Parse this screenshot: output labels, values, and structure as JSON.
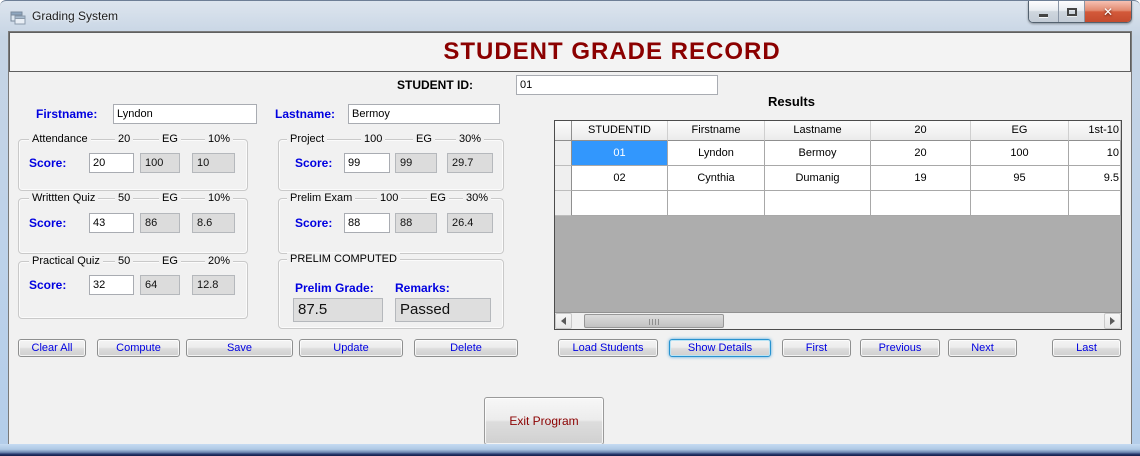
{
  "colors": {
    "maroon": "#8b0000",
    "blue": "#0000e0",
    "sel": "#3297fd",
    "formbg": "#f1f1f1"
  },
  "window": {
    "title": "Grading System"
  },
  "header": {
    "title": "STUDENT GRADE RECORD"
  },
  "student_id": {
    "label": "STUDENT ID:",
    "value": "01"
  },
  "firstname": {
    "label": "Firstname:",
    "value": "Lyndon"
  },
  "lastname": {
    "label": "Lastname:",
    "value": "Bermoy"
  },
  "score_label": "Score:",
  "groups": [
    {
      "caption": "Attendance",
      "max": "20",
      "eg_label": "EG",
      "percent": "10%",
      "score": "20",
      "eg": "100",
      "weighted": "10"
    },
    {
      "caption": "Writtten Quiz",
      "max": "50",
      "eg_label": "EG",
      "percent": "10%",
      "score": "43",
      "eg": "86",
      "weighted": "8.6"
    },
    {
      "caption": "Practical Quiz",
      "max": "50",
      "eg_label": "EG",
      "percent": "20%",
      "score": "32",
      "eg": "64",
      "weighted": "12.8"
    },
    {
      "caption": "Project",
      "max": "100",
      "eg_label": "EG",
      "percent": "30%",
      "score": "99",
      "eg": "99",
      "weighted": "29.7"
    },
    {
      "caption": "Prelim Exam",
      "max": "100",
      "eg_label": "EG",
      "percent": "30%",
      "score": "88",
      "eg": "88",
      "weighted": "26.4"
    }
  ],
  "prelim": {
    "caption": "PRELIM COMPUTED",
    "grade_label": "Prelim Grade:",
    "grade": "87.5",
    "remarks_label": "Remarks:",
    "remarks": "Passed"
  },
  "actions": {
    "clear": "Clear All",
    "compute": "Compute",
    "save": "Save",
    "update": "Update",
    "delete": "Delete"
  },
  "results": {
    "title": "Results",
    "columns": [
      "STUDENTID",
      "Firstname",
      "Lastname",
      "20",
      "EG",
      "1st-10"
    ],
    "rows": [
      [
        "01",
        "Lyndon",
        "Bermoy",
        "20",
        "100",
        "10"
      ],
      [
        "02",
        "Cynthia",
        "Dumanig",
        "19",
        "95",
        "9.5"
      ]
    ]
  },
  "nav": {
    "load": "Load Students",
    "details": "Show Details",
    "first": "First",
    "previous": "Previous",
    "next": "Next",
    "last": "Last"
  },
  "exit_label": "Exit Program"
}
